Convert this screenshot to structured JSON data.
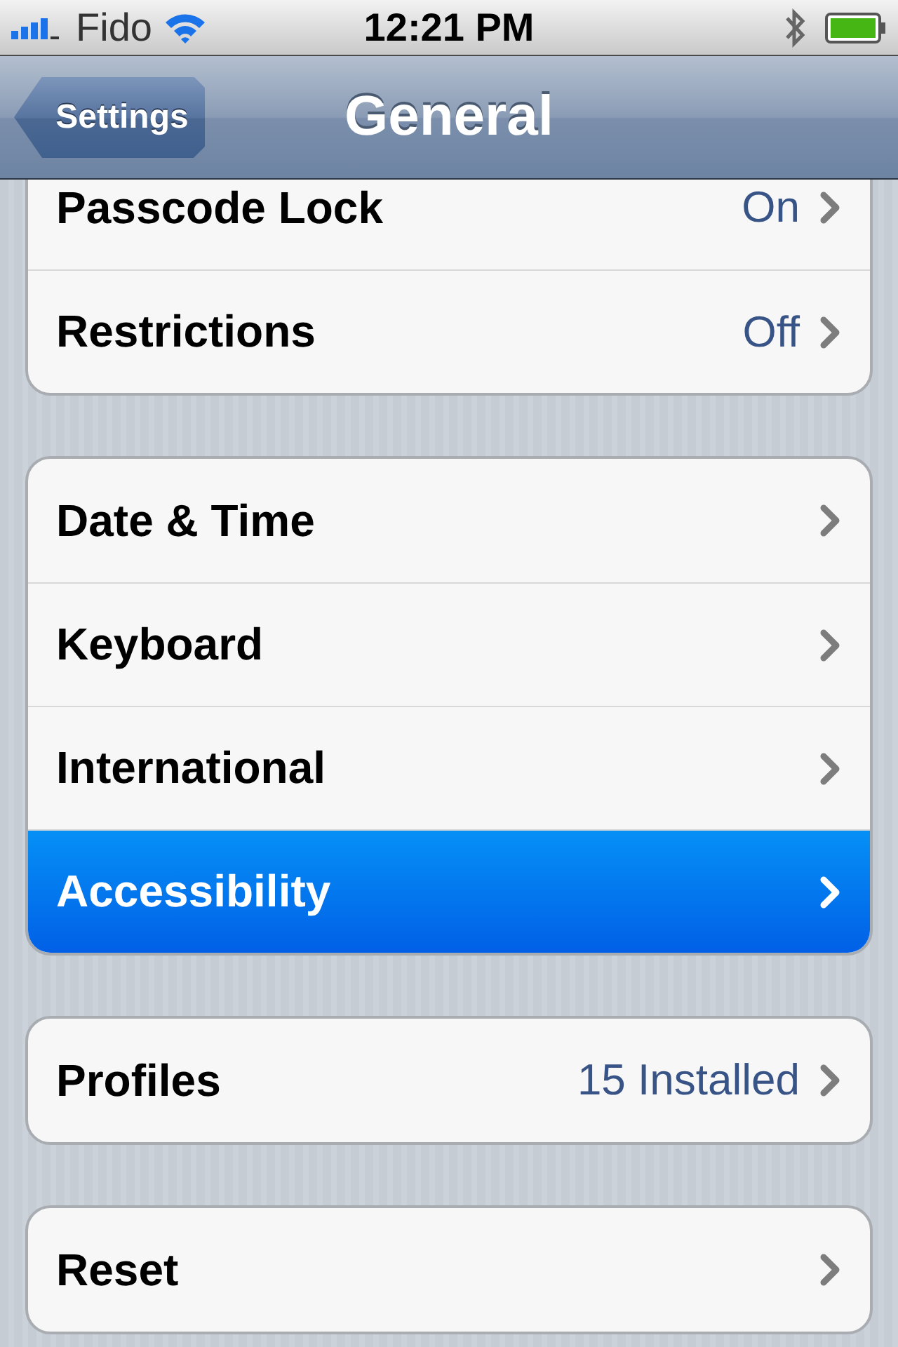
{
  "status_bar": {
    "carrier": "Fido",
    "time": "12:21 PM"
  },
  "nav_bar": {
    "back": "Settings",
    "title": "General"
  },
  "groups": [
    {
      "rows": [
        {
          "label": "Passcode Lock",
          "value": "On",
          "selected": false
        },
        {
          "label": "Restrictions",
          "value": "Off",
          "selected": false
        }
      ]
    },
    {
      "rows": [
        {
          "label": "Date & Time",
          "selected": false
        },
        {
          "label": "Keyboard",
          "selected": false
        },
        {
          "label": "International",
          "selected": false
        },
        {
          "label": "Accessibility",
          "selected": true
        }
      ]
    },
    {
      "rows": [
        {
          "label": "Profiles",
          "value": "15 Installed",
          "selected": false
        }
      ]
    },
    {
      "rows": [
        {
          "label": "Reset",
          "selected": false
        }
      ]
    }
  ]
}
